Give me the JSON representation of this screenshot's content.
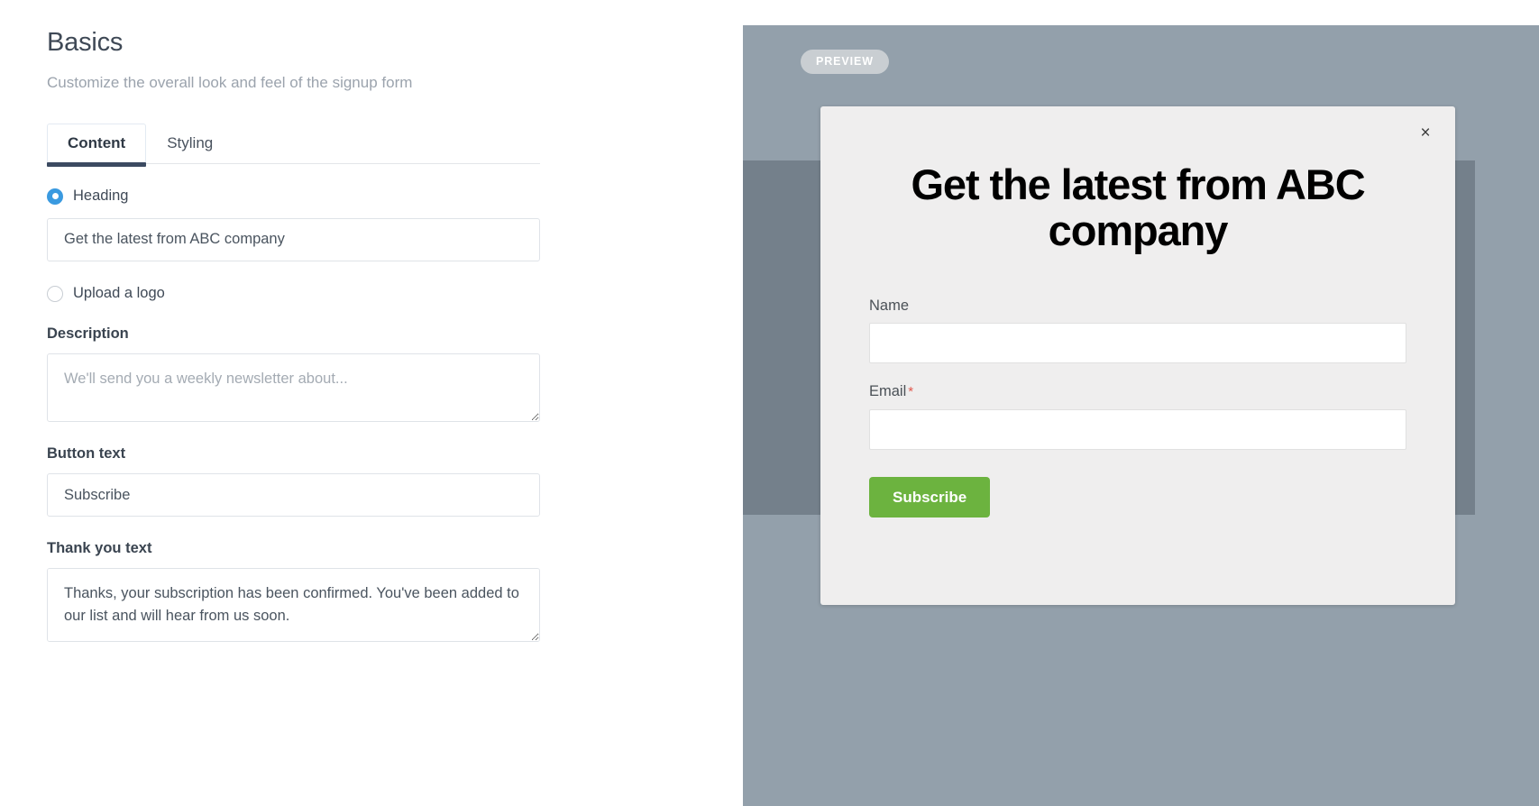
{
  "editor": {
    "title": "Basics",
    "subtitle": "Customize the overall look and feel of the signup form",
    "tabs": [
      {
        "label": "Content",
        "active": true
      },
      {
        "label": "Styling",
        "active": false
      }
    ],
    "heading_option": {
      "label": "Heading",
      "selected": true,
      "value": "Get the latest from ABC company",
      "placeholder": "Heading"
    },
    "logo_option": {
      "label": "Upload a logo",
      "selected": false
    },
    "description": {
      "label": "Description",
      "value": "",
      "placeholder": "We'll send you a weekly newsletter about..."
    },
    "button_text": {
      "label": "Button text",
      "value": "Subscribe",
      "placeholder": "Button text"
    },
    "thank_you_text": {
      "label": "Thank you text",
      "value": "Thanks, your subscription has been confirmed. You've been added to our list and will hear from us soon.",
      "placeholder": "Thank you text"
    }
  },
  "preview": {
    "badge": "PREVIEW",
    "close_icon": "×",
    "modal": {
      "heading": "Get the latest from ABC company",
      "fields": [
        {
          "label": "Name",
          "required": false,
          "value": "",
          "placeholder": ""
        },
        {
          "label": "Email",
          "required": true,
          "required_marker": "*",
          "value": "",
          "placeholder": ""
        }
      ],
      "submit_label": "Subscribe"
    }
  },
  "colors": {
    "accent_blue": "#3a9ae0",
    "tab_underline": "#3b4a61",
    "preview_bg": "#93a0ab",
    "backdrop_card": "#74808b",
    "modal_bg": "#efeeee",
    "subscribe_green": "#6cb33f",
    "required_red": "#e2584d"
  }
}
